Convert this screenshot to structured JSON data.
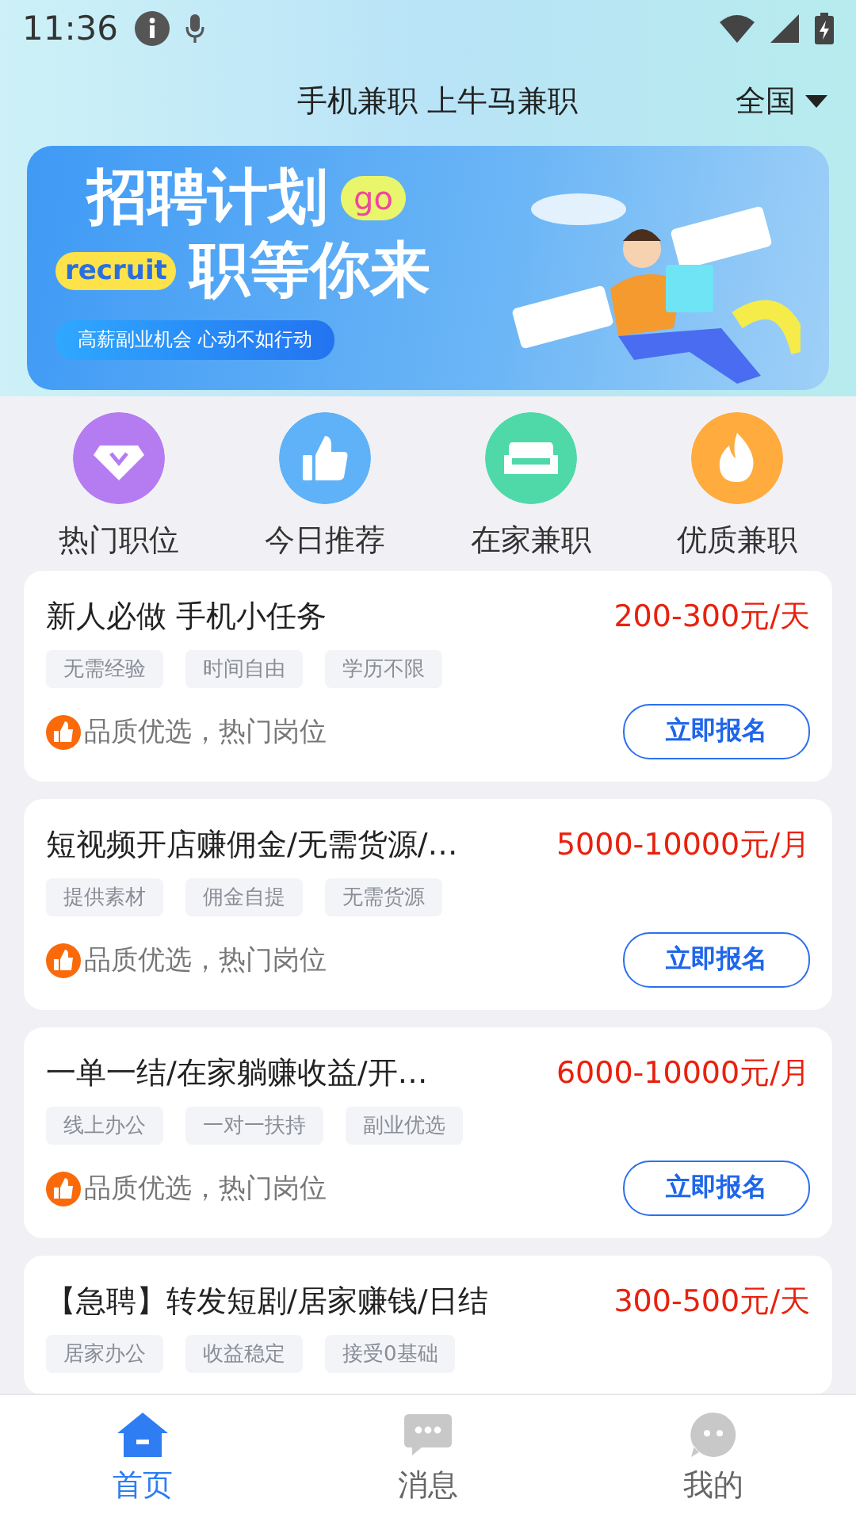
{
  "status_bar": {
    "time": "11:36"
  },
  "header": {
    "title": "手机兼职 上牛马兼职",
    "region": "全国"
  },
  "banner": {
    "headline_1": "招聘计划",
    "go_badge": "go",
    "recruit_badge": "recruit",
    "headline_2": "职等你来",
    "slogan": "高薪副业机会 心动不如行动"
  },
  "categories": [
    {
      "label": "热门职位",
      "kind": "gem",
      "color": "#b57cf2"
    },
    {
      "label": "今日推荐",
      "kind": "thumb",
      "color": "#5fb2f7"
    },
    {
      "label": "在家兼职",
      "kind": "sofa",
      "color": "#4fd9a8"
    },
    {
      "label": "优质兼职",
      "kind": "fire",
      "color": "#ffab3d"
    }
  ],
  "jobs": [
    {
      "title": "新人必做 手机小任务",
      "pay": "200-300元/天",
      "tags": [
        "无需经验",
        "时间自由",
        "学历不限"
      ],
      "note": "品质优选，热门岗位",
      "button": "立即报名"
    },
    {
      "title": "短视频开店赚佣金/无需货源/…",
      "pay": "5000-10000元/月",
      "tags": [
        "提供素材",
        "佣金自提",
        "无需货源"
      ],
      "note": "品质优选，热门岗位",
      "button": "立即报名"
    },
    {
      "title": "一单一结/在家躺赚收益/开…",
      "pay": "6000-10000元/月",
      "tags": [
        "线上办公",
        "一对一扶持",
        "副业优选"
      ],
      "note": "品质优选，热门岗位",
      "button": "立即报名"
    },
    {
      "title": "【急聘】转发短剧/居家赚钱/日结",
      "pay": "300-500元/天",
      "tags": [
        "居家办公",
        "收益稳定",
        "接受0基础"
      ]
    }
  ],
  "nav": [
    {
      "label": "首页",
      "kind": "home",
      "selected": true
    },
    {
      "label": "消息",
      "kind": "chat",
      "selected": false
    },
    {
      "label": "我的",
      "kind": "face",
      "selected": false
    }
  ]
}
